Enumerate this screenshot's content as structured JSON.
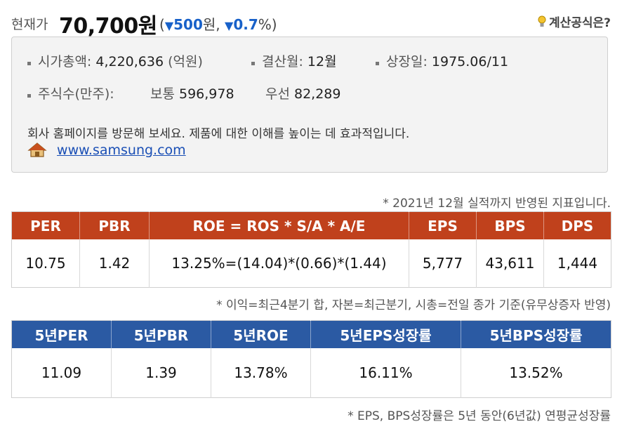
{
  "header": {
    "current_price_label": "현재가",
    "current_price": "70,700원",
    "change_open": "(",
    "change_arrow": "▼",
    "change_amount": "500",
    "change_amount_unit": "원, ",
    "change_arrow2": "▼",
    "change_percent": "0.7",
    "change_percent_unit": "%)",
    "calc_formula_link": "계산공식은?"
  },
  "info": {
    "market_cap_label": "시가총액: ",
    "market_cap_value": "4,220,636",
    "market_cap_unit": " (억원)",
    "fiscal_month_label": "결산월: ",
    "fiscal_month_value": "12월",
    "listing_date_label": "상장일: ",
    "listing_date_value": "1975.06/11",
    "shares_label": "주식수(만주):",
    "common_label": "보통 ",
    "common_value": "596,978",
    "preferred_label": "우선 ",
    "preferred_value": "82,289",
    "description": "회사 홈페이지를 방문해 보세요. 제품에 대한 이해를 높이는 데 효과적입니다.",
    "website": "www.samsung.com"
  },
  "notes": {
    "basis": "* 2021년 12월 실적까지 반영된 지표입니다.",
    "calc_basis": "* 이익=최근4분기 합, 자본=최근분기, 시총=전일 종가 기준(유무상증자 반영)",
    "growth_basis": "* EPS, BPS성장률은 5년 동안(6년값) 연평균성장률"
  },
  "ratios": {
    "headers": [
      "PER",
      "PBR",
      "ROE = ROS * S/A * A/E",
      "EPS",
      "BPS",
      "DPS"
    ],
    "values": [
      "10.75",
      "1.42",
      "13.25%=(14.04)*(0.66)*(1.44)",
      "5,777",
      "43,611",
      "1,444"
    ]
  },
  "five_year": {
    "headers": [
      "5년PER",
      "5년PBR",
      "5년ROE",
      "5년EPS성장률",
      "5년BPS성장률"
    ],
    "values": [
      "11.09",
      "1.39",
      "13.78%",
      "16.11%",
      "13.52%"
    ]
  },
  "colors": {
    "ratio_header_bg": "#c0411c",
    "five_year_header_bg": "#2b5aa3",
    "price_down": "#1861c9",
    "link": "#1a4fb5"
  }
}
